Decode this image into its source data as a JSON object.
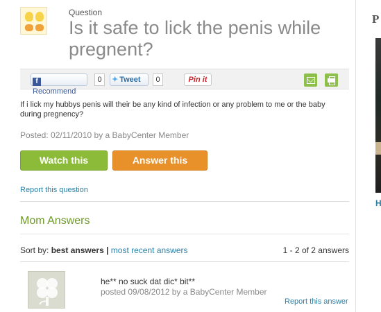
{
  "question": {
    "label": "Question",
    "title": "Is it safe to lick the penis while pregnent?",
    "body": "If i lick my hubbys penis will their be any kind of infection or any problem to me or the baby during pregnency?",
    "posted": "Posted: 02/11/2010 by a BabyCenter Member"
  },
  "share": {
    "facebook_label": "Recommend",
    "facebook_count": "0",
    "tweet_label": "Tweet",
    "tweet_count": "0",
    "pin_label": "Pin it",
    "icons": [
      "mail-icon",
      "print-icon"
    ]
  },
  "actions": {
    "watch_label": "Watch this",
    "answer_label": "Answer this",
    "report_question": "Report this question"
  },
  "answers_section": {
    "heading": "Mom Answers",
    "sort_prefix": "Sort by:",
    "sort_active": "best answers",
    "sort_separator": "|",
    "sort_other": "most recent answers",
    "count_text": "1 - 2 of 2 answers"
  },
  "answers": [
    {
      "text": "he** no suck dat dic* bit**",
      "posted": "posted 09/08/2012 by a BabyCenter Member",
      "report": "Report this answer"
    }
  ],
  "sidebar": {
    "heading_letter": "P",
    "link_letter": "H"
  },
  "colors": {
    "green": "#8cbb3a",
    "orange": "#e8912a",
    "link": "#2a7fa6",
    "section_heading": "#6f9a2a"
  }
}
